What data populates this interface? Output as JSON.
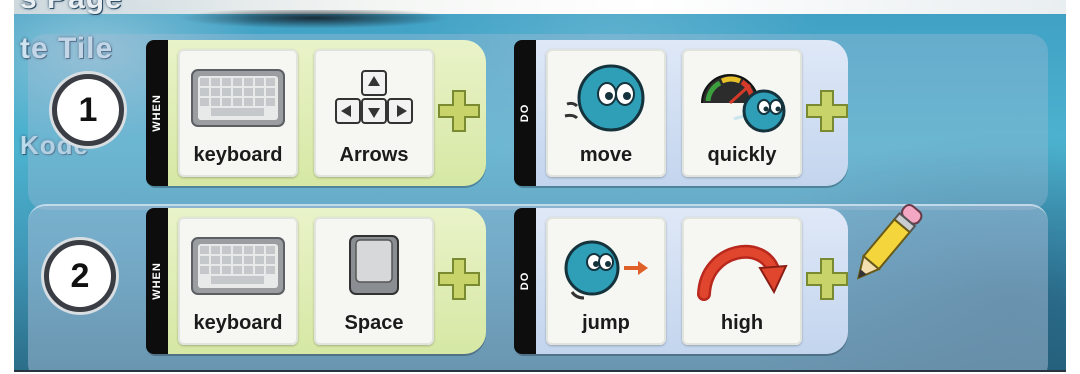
{
  "background_fragments": {
    "page_fragment": "s Page",
    "tile_fragment": "te Tile",
    "kode_fragment": "Kode"
  },
  "colors": {
    "when_block": "#d6e8a4",
    "do_block": "#c3d5ee",
    "plus": "#c8d46a",
    "workspace": "#4cb3cf"
  },
  "rules": [
    {
      "number": "1",
      "when_label": "WHEN",
      "do_label": "DO",
      "when_tiles": [
        {
          "label": "keyboard",
          "icon": "keyboard-icon"
        },
        {
          "label": "Arrows",
          "icon": "arrow-keys-icon"
        }
      ],
      "do_tiles": [
        {
          "label": "move",
          "icon": "kodu-move-icon"
        },
        {
          "label": "quickly",
          "icon": "speedometer-icon"
        }
      ]
    },
    {
      "number": "2",
      "when_label": "WHEN",
      "do_label": "DO",
      "when_tiles": [
        {
          "label": "keyboard",
          "icon": "keyboard-icon"
        },
        {
          "label": "Space",
          "icon": "space-key-icon"
        }
      ],
      "do_tiles": [
        {
          "label": "jump",
          "icon": "kodu-jump-icon"
        },
        {
          "label": "high",
          "icon": "curved-arrow-icon"
        }
      ]
    }
  ]
}
